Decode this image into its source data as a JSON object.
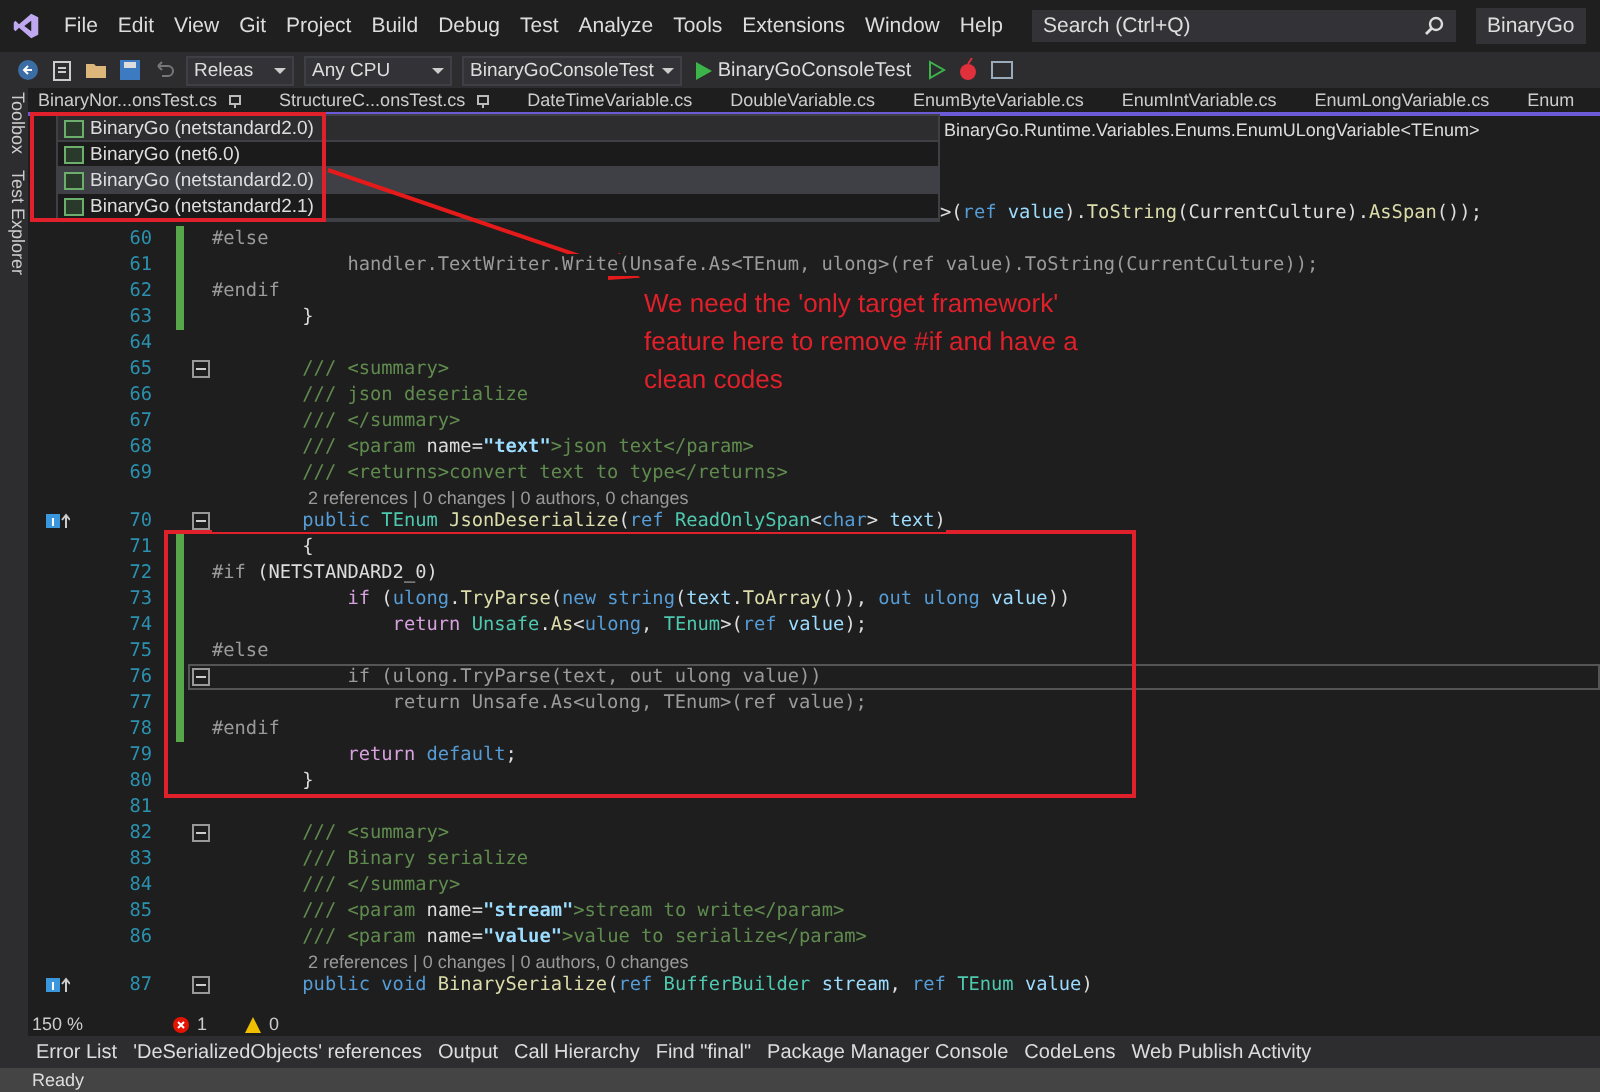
{
  "menu": {
    "items": [
      "File",
      "Edit",
      "View",
      "Git",
      "Project",
      "Build",
      "Debug",
      "Test",
      "Analyze",
      "Tools",
      "Extensions",
      "Window",
      "Help"
    ],
    "search": {
      "placeholder": "Search (Ctrl+Q)"
    },
    "solution": "BinaryGo"
  },
  "toolbar": {
    "configuration": "Releas",
    "platform": "Any CPU",
    "startup_project": "BinaryGoConsoleTest",
    "run_button": "BinaryGoConsoleTest"
  },
  "side_tabs": [
    "Toolbox",
    "Test Explorer"
  ],
  "tabs": [
    {
      "label": "BinaryNor...onsTest.cs",
      "pinned": true
    },
    {
      "label": "StructureC...onsTest.cs",
      "pinned": true
    },
    {
      "label": "DateTimeVariable.cs",
      "pinned": false
    },
    {
      "label": "DoubleVariable.cs",
      "pinned": false
    },
    {
      "label": "EnumByteVariable.cs",
      "pinned": false
    },
    {
      "label": "EnumIntVariable.cs",
      "pinned": false
    },
    {
      "label": "EnumLongVariable.cs",
      "pinned": false
    },
    {
      "label": "Enum",
      "pinned": false
    }
  ],
  "navigation_bar": {
    "project_combo": "BinaryGo (netstandard2.0)",
    "type_combo": "BinaryGo.Runtime.Variables.Enums.EnumULongVariable<TEnum>",
    "dropdown": [
      {
        "label": "BinaryGo (net6.0)",
        "selected": false
      },
      {
        "label": "BinaryGo (netstandard2.0)",
        "selected": true
      },
      {
        "label": "BinaryGo (netstandard2.1)",
        "selected": false
      }
    ]
  },
  "code": [
    {
      "kind": "clipped",
      "segments": [
        {
          "kind": "plain",
          "text": ">("
        },
        {
          "kind": "keyword",
          "text": "ref"
        },
        {
          "kind": "param",
          "text": " value"
        },
        {
          "kind": "plain",
          "text": ")."
        },
        {
          "kind": "method",
          "text": "ToString"
        },
        {
          "kind": "plain",
          "text": "(CurrentCulture)."
        },
        {
          "kind": "method",
          "text": "AsSpan"
        },
        {
          "kind": "plain",
          "text": "());"
        }
      ]
    },
    {
      "kind": "code",
      "number": "60",
      "changed": true,
      "segments": [
        {
          "kind": "preproc",
          "text": "#else"
        }
      ]
    },
    {
      "kind": "code",
      "number": "61",
      "changed": true,
      "segments": [
        {
          "kind": "inactive",
          "text": "            handler.TextWriter.Write(Unsafe.As<TEnum, ulong>(ref value).ToString(CurrentCulture));"
        }
      ]
    },
    {
      "kind": "code",
      "number": "62",
      "changed": true,
      "segments": [
        {
          "kind": "preproc",
          "text": "#endif"
        }
      ]
    },
    {
      "kind": "code",
      "number": "63",
      "changed": true,
      "segments": [
        {
          "kind": "plain",
          "text": "        }"
        }
      ]
    },
    {
      "kind": "code",
      "number": "64"
    },
    {
      "kind": "code",
      "number": "65",
      "fold": true,
      "segments": [
        {
          "kind": "doc",
          "text": "        /// <summary>"
        }
      ]
    },
    {
      "kind": "code",
      "number": "66",
      "segments": [
        {
          "kind": "doc",
          "text": "        /// json deserialize"
        }
      ]
    },
    {
      "kind": "code",
      "number": "67",
      "segments": [
        {
          "kind": "doc",
          "text": "        /// </summary>"
        }
      ]
    },
    {
      "kind": "code",
      "number": "68",
      "segments": [
        {
          "kind": "doc",
          "text": "        /// <param "
        },
        {
          "kind": "plain",
          "text": "name="
        },
        {
          "kind": "docvalue",
          "text": "\"text\""
        },
        {
          "kind": "doc",
          "text": ">json text</param>"
        }
      ]
    },
    {
      "kind": "code",
      "number": "69",
      "segments": [
        {
          "kind": "doc",
          "text": "        /// <returns>convert text to type</returns>"
        }
      ]
    },
    {
      "kind": "codelens",
      "text": "2 references | 0 changes | 0 authors, 0 changes"
    },
    {
      "kind": "code",
      "number": "70",
      "fold": true,
      "marker": true,
      "segments": [
        {
          "kind": "keyword",
          "text": "        public "
        },
        {
          "kind": "type",
          "text": "TEnum "
        },
        {
          "kind": "method",
          "text": "JsonDeserialize"
        },
        {
          "kind": "plain",
          "text": "("
        },
        {
          "kind": "keyword",
          "text": "ref "
        },
        {
          "kind": "type",
          "text": "ReadOnlySpan"
        },
        {
          "kind": "plain",
          "text": "<"
        },
        {
          "kind": "keyword",
          "text": "char"
        },
        {
          "kind": "plain",
          "text": "> "
        },
        {
          "kind": "param",
          "text": "text"
        },
        {
          "kind": "plain",
          "text": ")"
        }
      ]
    },
    {
      "kind": "code",
      "number": "71",
      "changed": true,
      "segments": [
        {
          "kind": "plain",
          "text": "        {"
        }
      ]
    },
    {
      "kind": "code",
      "number": "72",
      "changed": true,
      "segments": [
        {
          "kind": "preproc",
          "text": "#if "
        },
        {
          "kind": "plain",
          "text": "(NETSTANDARD2_0)"
        }
      ]
    },
    {
      "kind": "code",
      "number": "73",
      "changed": true,
      "segments": [
        {
          "kind": "control",
          "text": "            if "
        },
        {
          "kind": "plain",
          "text": "("
        },
        {
          "kind": "keyword",
          "text": "ulong"
        },
        {
          "kind": "plain",
          "text": "."
        },
        {
          "kind": "method",
          "text": "TryParse"
        },
        {
          "kind": "plain",
          "text": "("
        },
        {
          "kind": "keyword",
          "text": "new string"
        },
        {
          "kind": "plain",
          "text": "("
        },
        {
          "kind": "param",
          "text": "text"
        },
        {
          "kind": "plain",
          "text": "."
        },
        {
          "kind": "method",
          "text": "ToArray"
        },
        {
          "kind": "plain",
          "text": "()), "
        },
        {
          "kind": "keyword",
          "text": "out ulong "
        },
        {
          "kind": "param",
          "text": "value"
        },
        {
          "kind": "plain",
          "text": "))"
        }
      ]
    },
    {
      "kind": "code",
      "number": "74",
      "changed": true,
      "segments": [
        {
          "kind": "control",
          "text": "                return "
        },
        {
          "kind": "type",
          "text": "Unsafe"
        },
        {
          "kind": "plain",
          "text": "."
        },
        {
          "kind": "method",
          "text": "As"
        },
        {
          "kind": "plain",
          "text": "<"
        },
        {
          "kind": "keyword",
          "text": "ulong"
        },
        {
          "kind": "plain",
          "text": ", "
        },
        {
          "kind": "type",
          "text": "TEnum"
        },
        {
          "kind": "plain",
          "text": ">("
        },
        {
          "kind": "keyword",
          "text": "ref "
        },
        {
          "kind": "param",
          "text": "value"
        },
        {
          "kind": "plain",
          "text": ");"
        }
      ]
    },
    {
      "kind": "code",
      "number": "75",
      "changed": true,
      "segments": [
        {
          "kind": "preproc",
          "text": "#else"
        }
      ]
    },
    {
      "kind": "code",
      "number": "76",
      "changed": true,
      "fold": true,
      "current": true,
      "segments": [
        {
          "kind": "inactive",
          "text": "            if (ulong.TryParse(text, out ulong value))"
        }
      ]
    },
    {
      "kind": "code",
      "number": "77",
      "changed": true,
      "segments": [
        {
          "kind": "inactive",
          "text": "                return Unsafe.As<ulong, TEnum>(ref value);"
        }
      ]
    },
    {
      "kind": "code",
      "number": "78",
      "changed": true,
      "segments": [
        {
          "kind": "preproc",
          "text": "#endif"
        }
      ]
    },
    {
      "kind": "code",
      "number": "79",
      "segments": [
        {
          "kind": "control",
          "text": "            return "
        },
        {
          "kind": "keyword",
          "text": "default"
        },
        {
          "kind": "plain",
          "text": ";"
        }
      ]
    },
    {
      "kind": "code",
      "number": "80",
      "segments": [
        {
          "kind": "plain",
          "text": "        }"
        }
      ]
    },
    {
      "kind": "code",
      "number": "81"
    },
    {
      "kind": "code",
      "number": "82",
      "fold": true,
      "segments": [
        {
          "kind": "doc",
          "text": "        /// <summary>"
        }
      ]
    },
    {
      "kind": "code",
      "number": "83",
      "segments": [
        {
          "kind": "doc",
          "text": "        /// Binary serialize"
        }
      ]
    },
    {
      "kind": "code",
      "number": "84",
      "segments": [
        {
          "kind": "doc",
          "text": "        /// </summary>"
        }
      ]
    },
    {
      "kind": "code",
      "number": "85",
      "segments": [
        {
          "kind": "doc",
          "text": "        /// <param "
        },
        {
          "kind": "plain",
          "text": "name="
        },
        {
          "kind": "docvalue",
          "text": "\"stream\""
        },
        {
          "kind": "doc",
          "text": ">stream to write</param>"
        }
      ]
    },
    {
      "kind": "code",
      "number": "86",
      "segments": [
        {
          "kind": "doc",
          "text": "        /// <param "
        },
        {
          "kind": "plain",
          "text": "name="
        },
        {
          "kind": "docvalue",
          "text": "\"value\""
        },
        {
          "kind": "doc",
          "text": ">value to serialize</param>"
        }
      ]
    },
    {
      "kind": "codelens",
      "text": "2 references | 0 changes | 0 authors, 0 changes"
    },
    {
      "kind": "code",
      "number": "87",
      "fold": true,
      "marker": true,
      "segments": [
        {
          "kind": "keyword",
          "text": "        public void "
        },
        {
          "kind": "method",
          "text": "BinarySerialize"
        },
        {
          "kind": "plain",
          "text": "("
        },
        {
          "kind": "keyword",
          "text": "ref "
        },
        {
          "kind": "type",
          "text": "BufferBuilder "
        },
        {
          "kind": "param",
          "text": "stream"
        },
        {
          "kind": "plain",
          "text": ", "
        },
        {
          "kind": "keyword",
          "text": "ref "
        },
        {
          "kind": "type",
          "text": "TEnum "
        },
        {
          "kind": "param",
          "text": "value"
        },
        {
          "kind": "plain",
          "text": ")"
        }
      ]
    }
  ],
  "annotation": {
    "text": "We need the 'only target framework' feature here to remove #if and have a clean codes"
  },
  "editor_status": {
    "zoom": "150 %",
    "errors": "1",
    "warnings": "0"
  },
  "tool_tabs": [
    "Error List",
    "'DeSerializedObjects' references",
    "Output",
    "Call Hierarchy",
    "Find \"final\"",
    "Package Manager Console",
    "CodeLens",
    "Web Publish Activity"
  ],
  "status_bar": {
    "text": "Ready"
  }
}
